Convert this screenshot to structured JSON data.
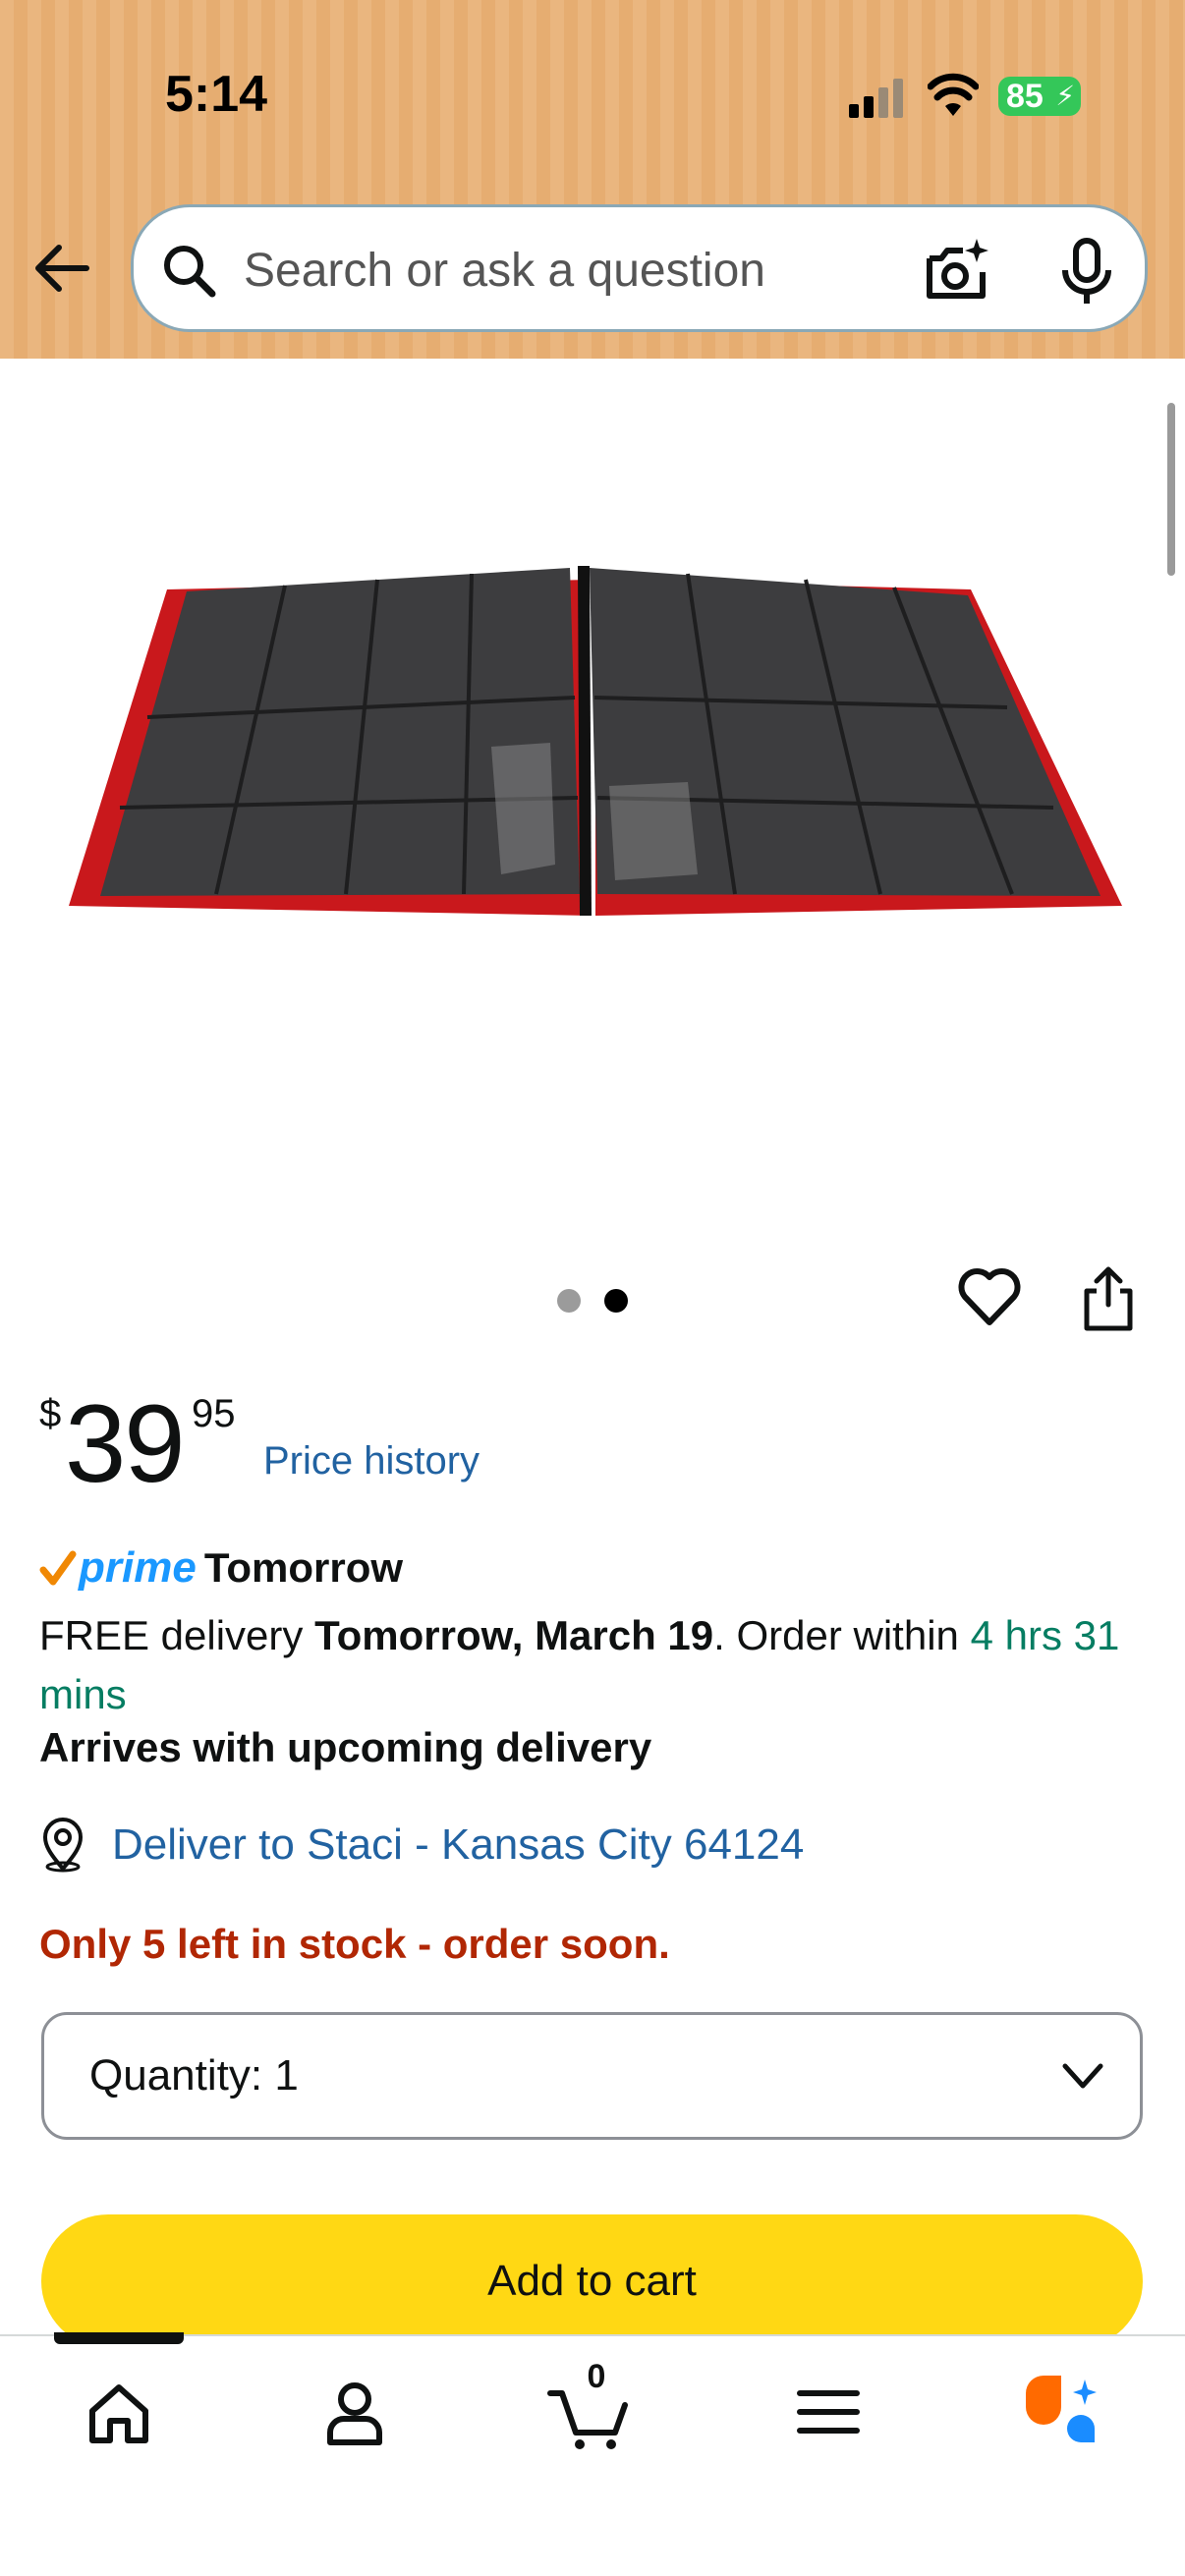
{
  "status_bar": {
    "time": "5:14",
    "battery": "85"
  },
  "search": {
    "placeholder": "Search or ask a question"
  },
  "carousel": {
    "total": 2,
    "active": 2
  },
  "price": {
    "symbol": "$",
    "whole": "39",
    "fraction": "95",
    "history_link": "Price history"
  },
  "delivery": {
    "prime_label": "prime",
    "prime_speed": "Tomorrow",
    "free_delivery_prefix": "FREE delivery ",
    "delivery_date": "Tomorrow, March 19",
    "order_within_prefix": ". Order within ",
    "countdown": "4 hrs 31 mins",
    "arrives_note": "Arrives with upcoming delivery"
  },
  "location": {
    "text": "Deliver to Staci - Kansas City 64124"
  },
  "stock": {
    "message": "Only 5 left in stock - order soon."
  },
  "quantity": {
    "label": "Quantity:",
    "value": "1"
  },
  "add_to_cart": {
    "label": "Add to cart"
  },
  "bottom_nav": {
    "cart_count": "0",
    "items": [
      "home-icon",
      "account-icon",
      "cart-icon",
      "menu-icon",
      "rufus-icon"
    ]
  },
  "colors": {
    "header_bg": "#eab67f",
    "link": "#2162a1",
    "prime_blue": "#1a98ff",
    "prime_check": "#f08804",
    "green": "#067d62",
    "stock_red": "#b12704",
    "cart_button": "#ffd814",
    "rufus_orange": "#ff6a00",
    "rufus_blue": "#1a8cff"
  }
}
